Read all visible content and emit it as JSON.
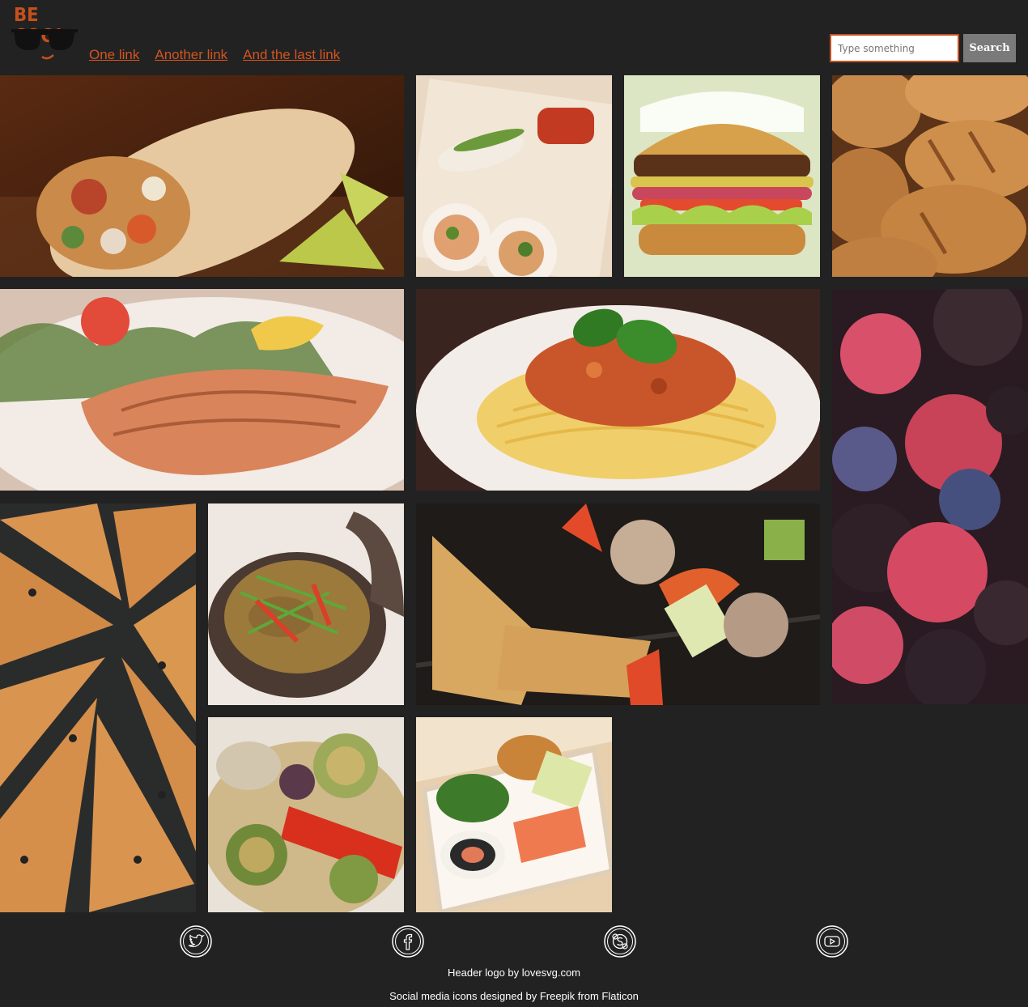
{
  "header": {
    "logo_text": "BE COOL",
    "nav_links": [
      "One link",
      "Another link",
      "And the last link"
    ],
    "search_placeholder": "Type something",
    "search_button": "Search"
  },
  "colors": {
    "background": "#222222",
    "accent": "#d4541f",
    "search_button_bg": "#7a7a7a"
  },
  "gallery": [
    {
      "subject": "burrito"
    },
    {
      "subject": "spring rolls"
    },
    {
      "subject": "burger"
    },
    {
      "subject": "bread rolls"
    },
    {
      "subject": "grilled salmon"
    },
    {
      "subject": "spaghetti bolognese"
    },
    {
      "subject": "berries"
    },
    {
      "subject": "pizza"
    },
    {
      "subject": "curry pot"
    },
    {
      "subject": "grilled vegetable skewers"
    },
    {
      "subject": "roasted vegetables"
    },
    {
      "subject": "sushi box"
    }
  ],
  "footer": {
    "social_icons": [
      "twitter-icon",
      "facebook-icon",
      "skype-icon",
      "youtube-icon"
    ],
    "credit_logo": "Header logo by lovesvg.com",
    "credit_icons": "Social media icons designed by Freepik from Flaticon"
  }
}
